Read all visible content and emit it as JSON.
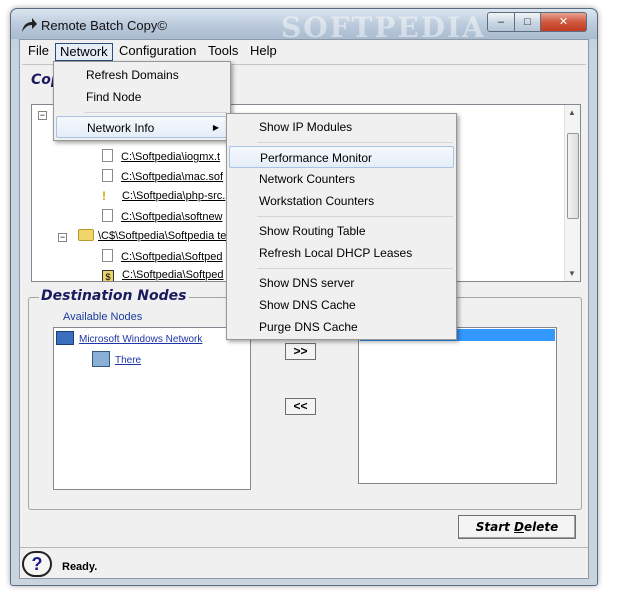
{
  "window": {
    "title": "Remote Batch Copy©",
    "watermark": "SOFTPEDIA",
    "buttons": {
      "minimize": "–",
      "maximize": "□",
      "close": "✕"
    }
  },
  "menubar": [
    "File",
    "Network",
    "Configuration",
    "Tools",
    "Help"
  ],
  "copy_section": {
    "title": "Cop"
  },
  "tree": {
    "rows": [
      {
        "type": "file",
        "text": "C:\\Softpedia\\iogmx.t"
      },
      {
        "type": "file",
        "text": "C:\\Softpedia\\mac.sof"
      },
      {
        "type": "warn",
        "text": "C:\\Softpedia\\php-src."
      },
      {
        "type": "file",
        "text": "C:\\Softpedia\\softnew"
      },
      {
        "type": "folder",
        "text": "\\C$\\Softpedia\\Softpedia te"
      },
      {
        "type": "file",
        "text": "C:\\Softpedia\\Softped"
      },
      {
        "type": "script",
        "text": "C:\\Softpedia\\Softped"
      }
    ]
  },
  "destination": {
    "title": "Destination Nodes",
    "available_label": "Available Nodes",
    "nodes": [
      "Microsoft Windows Network",
      "There"
    ],
    "add_button": ">>",
    "remove_button": "<<"
  },
  "start_button": {
    "prefix": "Start ",
    "mnemonic": "D",
    "suffix": "elete"
  },
  "status": {
    "help": "?",
    "text": "Ready."
  },
  "network_menu": {
    "items": [
      "Refresh Domains",
      "Find Node",
      "Network Info"
    ],
    "submenu_arrow": "▶"
  },
  "network_info_submenu": {
    "groups": [
      [
        "Show IP Modules"
      ],
      [
        "Performance Monitor",
        "Network Counters",
        "Workstation Counters"
      ],
      [
        "Show Routing Table",
        "Refresh Local DHCP Leases"
      ],
      [
        "Show  DNS server",
        "Show  DNS Cache",
        "Purge  DNS Cache"
      ]
    ],
    "highlighted": "Performance Monitor"
  }
}
